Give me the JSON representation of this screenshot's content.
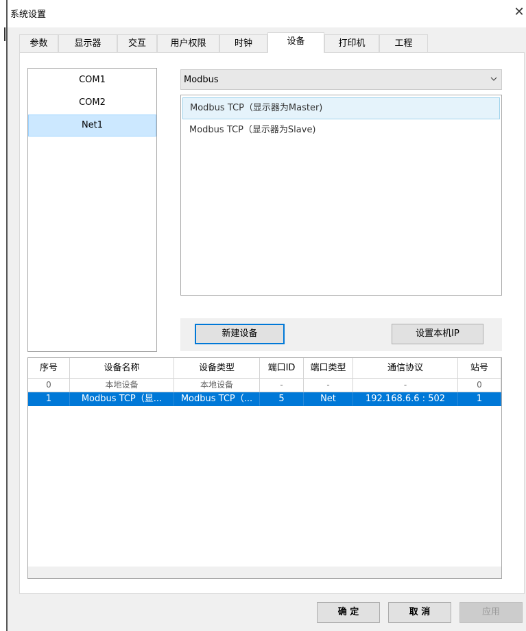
{
  "window": {
    "title": "系统设置",
    "close": "✕"
  },
  "tabs": [
    {
      "label": "参数"
    },
    {
      "label": "显示器"
    },
    {
      "label": "交互"
    },
    {
      "label": "用户权限"
    },
    {
      "label": "时钟"
    },
    {
      "label": "设备"
    },
    {
      "label": "打印机"
    },
    {
      "label": "工程"
    }
  ],
  "active_tab": "设备",
  "ports": [
    {
      "label": "COM1"
    },
    {
      "label": "COM2"
    },
    {
      "label": "Net1"
    }
  ],
  "selected_port": "Net1",
  "protocol_select": {
    "value": "Modbus",
    "icon": "chevron-down-icon"
  },
  "drivers": [
    {
      "label": "Modbus  TCP（显示器为Master)"
    },
    {
      "label": "Modbus  TCP（显示器为Slave)"
    }
  ],
  "selected_driver": "Modbus  TCP（显示器为Master)",
  "buttons": {
    "new_device": "新建设备",
    "set_local_ip": "设置本机IP"
  },
  "device_table": {
    "columns": [
      "序号",
      "设备名称",
      "设备类型",
      "端口ID",
      "端口类型",
      "通信协议",
      "站号"
    ],
    "rows": [
      [
        "0",
        "本地设备",
        "本地设备",
        "-",
        "-",
        "-",
        "0"
      ],
      [
        "1",
        "Modbus TCP（显...",
        "Modbus TCP（...",
        "5",
        "Net",
        "192.168.6.6 : 502",
        "1"
      ]
    ],
    "selected_row": 1
  },
  "footer": {
    "ok": "确 定",
    "cancel": "取 消",
    "apply": "应用"
  },
  "colors": {
    "selection": "#0078d7",
    "list_selection": "#cce8ff",
    "dialog_bg": "#f0f0f0"
  }
}
